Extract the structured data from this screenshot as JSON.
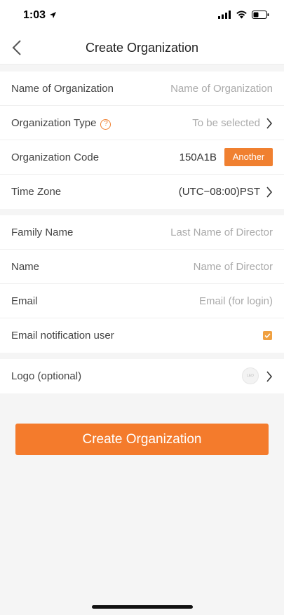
{
  "status": {
    "time": "1:03"
  },
  "nav": {
    "title": "Create Organization"
  },
  "org": {
    "name_label": "Name of Organization",
    "name_placeholder": "Name of Organization",
    "type_label": "Organization Type",
    "type_help": "?",
    "type_value": "To be selected",
    "code_label": "Organization Code",
    "code_value": "150A1B",
    "another_label": "Another",
    "tz_label": "Time Zone",
    "tz_value": "(UTC−08:00)PST"
  },
  "director": {
    "family_label": "Family Name",
    "family_placeholder": "Last Name of Director",
    "name_label": "Name",
    "name_placeholder": "Name of Director",
    "email_label": "Email",
    "email_placeholder": "Email (for login)",
    "notify_label": "Email notification user",
    "notify_checked": true
  },
  "logo": {
    "label": "Logo (optional)",
    "thumb_text": "LED"
  },
  "actions": {
    "create_label": "Create Organization"
  },
  "colors": {
    "accent": "#f47b2c",
    "checkbox": "#f0a040"
  }
}
